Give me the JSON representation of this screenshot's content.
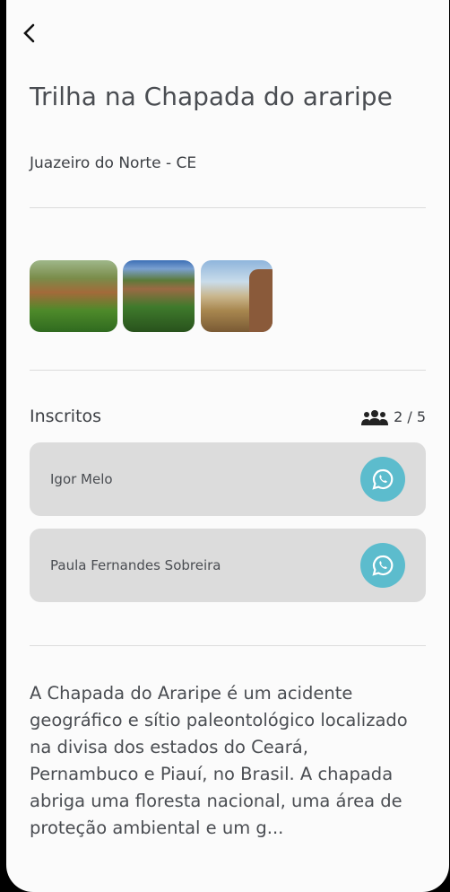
{
  "header": {
    "back_icon": "chevron-left-icon"
  },
  "event": {
    "title": "Trilha na Chapada do araripe",
    "location": "Juazeiro do Norte - CE"
  },
  "photos": [
    "photo-1",
    "photo-2",
    "photo-3"
  ],
  "participants": {
    "label": "Inscritos",
    "count": "2 / 5",
    "icon": "users-icon",
    "items": [
      {
        "name": "Igor Melo"
      },
      {
        "name": "Paula Fernandes Sobreira"
      }
    ],
    "contact_icon": "whatsapp-icon",
    "accent": "#5cbccd"
  },
  "description": "A Chapada do Araripe é um acidente geográfico e sítio paleontológico localizado na divisa dos estados do Ceará, Pernambuco e Piauí, no Brasil. A chapada abriga uma floresta nacional, uma área de proteção ambiental e um g..."
}
